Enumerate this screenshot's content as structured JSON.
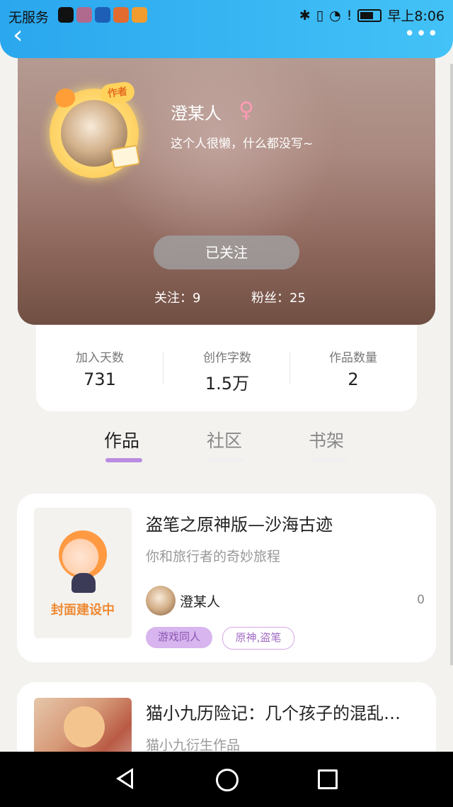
{
  "status_bar": {
    "carrier": "无服务",
    "time": "早上8:06"
  },
  "header": {
    "back_icon": "chevron-left-icon",
    "more_icon": "more-horizontal-icon"
  },
  "profile": {
    "name": "澄某人",
    "gender_icon": "female-icon",
    "bio": "这个人很懒，什么都没写~",
    "author_badge": "作者",
    "follow_button": "已关注",
    "following": "关注：9",
    "fans": "粉丝：25"
  },
  "stats": [
    {
      "label": "加入天数",
      "value": "731"
    },
    {
      "label": "创作字数",
      "value": "1.5万"
    },
    {
      "label": "作品数量",
      "value": "2"
    }
  ],
  "tabs": [
    {
      "label": "作品"
    },
    {
      "label": "社区"
    },
    {
      "label": "书架"
    }
  ],
  "works": [
    {
      "title": "盗笔之原神版—沙海古迹",
      "description": "你和旅行者的奇妙旅程",
      "cover_text": "封面建设中",
      "author": "澄某人",
      "count": "0",
      "tags": [
        "游戏同人",
        "原神,盗笔"
      ]
    },
    {
      "title": "猫小九历险记：几个孩子的混乱…",
      "description": "猫小九衍生作品"
    }
  ],
  "colors": {
    "status_bar": "#2aa7ee",
    "accent_purple": "#b98de0",
    "tag_purple": "#d8b5ee"
  }
}
